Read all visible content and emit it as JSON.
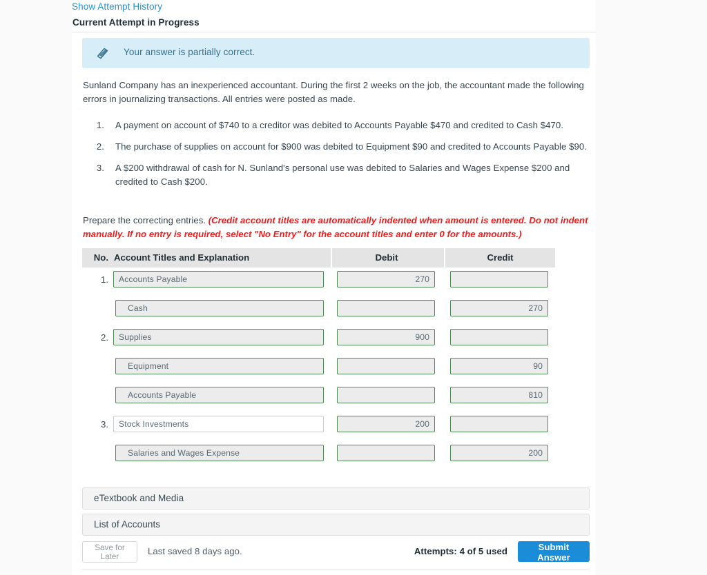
{
  "header": {
    "attempt_history_link": "Show Attempt History",
    "current_attempt_label": "Current Attempt in Progress"
  },
  "banner": {
    "icon": "eraser-icon",
    "message": "Your answer is partially correct.",
    "background_color": "#d7edf7",
    "text_color": "#31708f"
  },
  "problem": {
    "intro": "Sunland Company has an inexperienced accountant. During the first 2 weeks on the job, the accountant made the following errors in journalizing transactions. All entries were posted as made.",
    "errors": [
      {
        "number": "1.",
        "text": "A payment on account of $740 to a creditor was debited to Accounts Payable $470 and credited to Cash $470."
      },
      {
        "number": "2.",
        "text": "The purchase of supplies on account for $900 was debited to Equipment $90 and credited to Accounts Payable $90."
      },
      {
        "number": "3.",
        "text": "A $200 withdrawal of cash for N. Sunland's personal use was debited to Salaries and Wages Expense $200 and credited to Cash $200."
      }
    ],
    "prepare_label": "Prepare the correcting entries.",
    "prepare_note": "(Credit account titles are automatically indented when amount is entered. Do not indent manually. If no entry is required, select \"No Entry\" for the account titles and enter 0 for the amounts.)",
    "note_color": "#f51b1b"
  },
  "journal": {
    "columns": {
      "no": "No.",
      "account": "Account Titles and Explanation",
      "debit": "Debit",
      "credit": "Credit"
    },
    "rows": [
      {
        "no": "1.",
        "account": "Accounts Payable",
        "debit": "270",
        "credit": "",
        "indented": false,
        "state": "correct"
      },
      {
        "no": "",
        "account": "Cash",
        "debit": "",
        "credit": "270",
        "indented": true,
        "state": "correct"
      },
      {
        "no": "2.",
        "account": "Supplies",
        "debit": "900",
        "credit": "",
        "indented": false,
        "state": "correct"
      },
      {
        "no": "",
        "account": "Equipment",
        "debit": "",
        "credit": "90",
        "indented": true,
        "state": "correct"
      },
      {
        "no": "",
        "account": "Accounts Payable",
        "debit": "",
        "credit": "810",
        "indented": true,
        "state": "correct"
      },
      {
        "no": "3.",
        "account": "Stock Investments",
        "debit": "200",
        "credit": "",
        "indented": false,
        "state": "neutral"
      },
      {
        "no": "",
        "account": "Salaries and Wages Expense",
        "debit": "",
        "credit": "200",
        "indented": true,
        "state": "correct"
      }
    ]
  },
  "accordions": {
    "etextbook": "eTextbook and Media",
    "list_of_accounts": "List of Accounts"
  },
  "footer": {
    "save_for_later": "Save for Later",
    "last_saved": "Last saved 8 days ago.",
    "attempts": "Attempts: 4 of 5 used",
    "submit": "Submit Answer",
    "submit_color": "#1a8cd8"
  }
}
